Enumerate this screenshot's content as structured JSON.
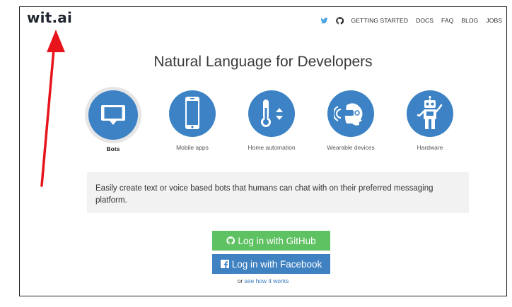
{
  "header": {
    "logo": "wit.ai",
    "nav": [
      {
        "icon": "twitter-icon"
      },
      {
        "icon": "github-icon"
      },
      {
        "label": "GETTING STARTED"
      },
      {
        "label": "DOCS"
      },
      {
        "label": "FAQ"
      },
      {
        "label": "BLOG"
      },
      {
        "label": "JOBS"
      }
    ]
  },
  "main": {
    "headline": "Natural Language for Developers",
    "use_cases": [
      {
        "label": "Bots",
        "icon": "chat-bubble-icon",
        "selected": true
      },
      {
        "label": "Mobile apps",
        "icon": "smartphone-icon",
        "selected": false
      },
      {
        "label": "Home automation",
        "icon": "thermostat-icon",
        "selected": false
      },
      {
        "label": "Wearable devices",
        "icon": "wearable-headset-icon",
        "selected": false
      },
      {
        "label": "Hardware",
        "icon": "robot-icon",
        "selected": false
      }
    ],
    "description": "Easily create text or voice based bots that humans can chat with on their preferred messaging platform.",
    "github_button": "Log in with GitHub",
    "facebook_button": "Log in with Facebook",
    "hint_prefix": "or ",
    "hint_link": "see how it works"
  },
  "colors": {
    "accent_blue": "#3c82c4",
    "github_green": "#5fc262",
    "facebook_blue": "#3f81c1",
    "annotation_red": "#e8141b"
  }
}
